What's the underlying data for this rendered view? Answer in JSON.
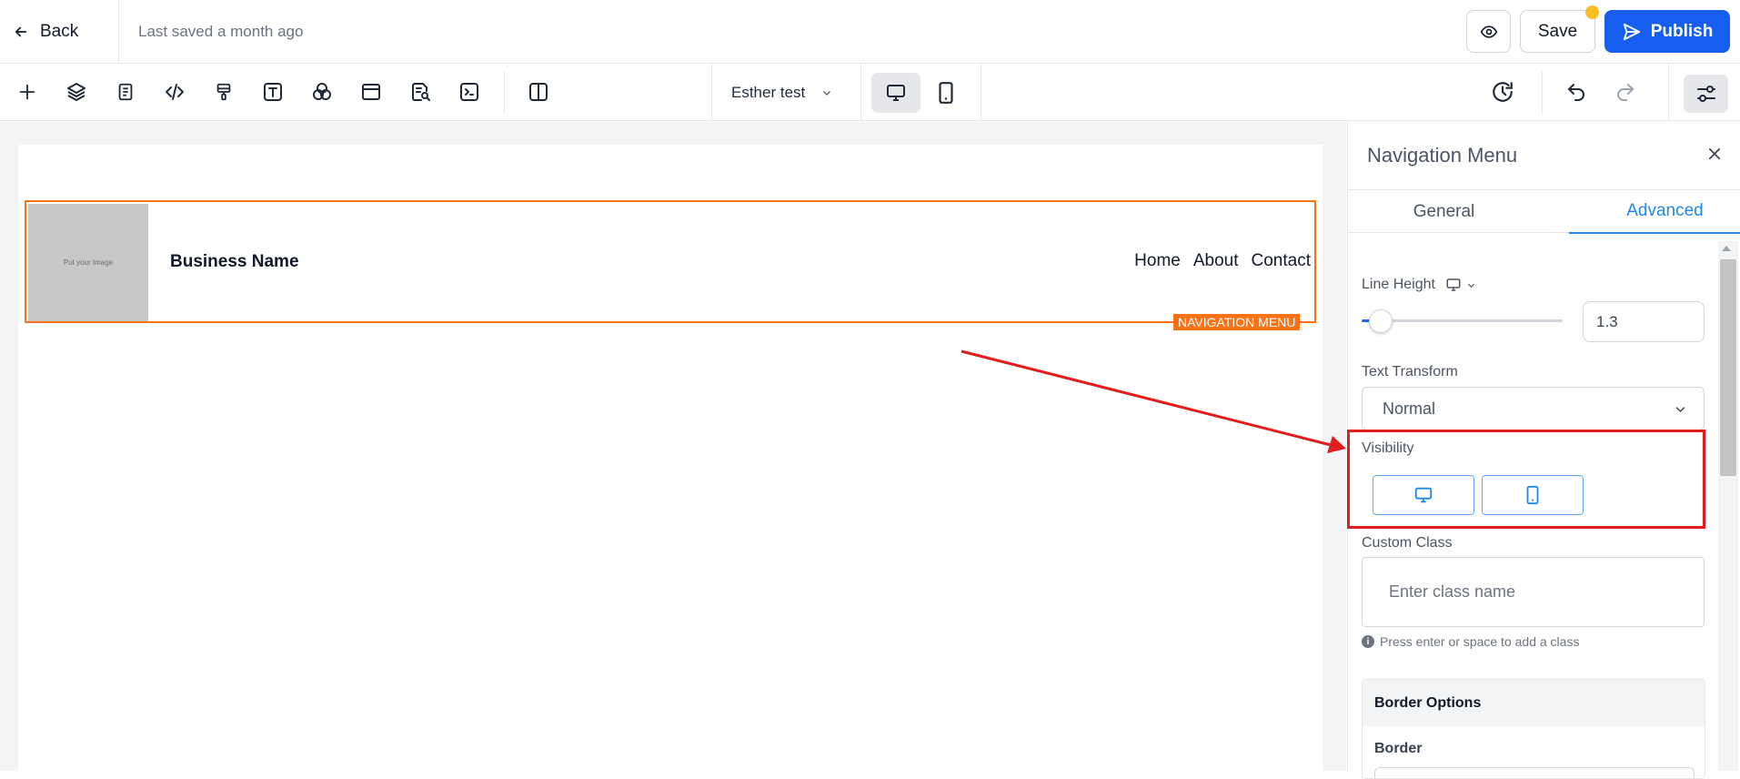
{
  "header": {
    "back_label": "Back",
    "saved_status": "Last saved a month ago",
    "save_label": "Save",
    "publish_label": "Publish"
  },
  "toolbar": {
    "page_selector": "Esther test",
    "tools": [
      "add-icon",
      "layers-icon",
      "page-icon",
      "code-icon",
      "paint-roller-icon",
      "text-icon",
      "blend-icon",
      "browser-window-icon",
      "seo-search-icon",
      "terminal-icon",
      "split-view-icon"
    ],
    "device_mode": "desktop"
  },
  "canvas": {
    "image_placeholder": "Put your Image",
    "business_name": "Business Name",
    "nav_links": [
      "Home",
      "About",
      "Contact"
    ],
    "element_tag": "NAVIGATION MENU"
  },
  "panel": {
    "title": "Navigation Menu",
    "tabs": [
      "General",
      "Advanced"
    ],
    "active_tab": "Advanced",
    "line_height_label": "Line Height",
    "line_height_value": "1.3",
    "line_height_slider": 0.05,
    "text_transform_label": "Text Transform",
    "text_transform_value": "Normal",
    "visibility_label": "Visibility",
    "custom_class_label": "Custom Class",
    "custom_class_placeholder": "Enter class name",
    "custom_class_hint": "Press enter or space to add a class",
    "border_options_label": "Border Options",
    "border_label": "Border"
  },
  "colors": {
    "primary": "#155eef",
    "accent_blue": "#1e88e5",
    "selection_orange": "#f97316",
    "annotation_red": "#e11d1d",
    "unsaved_dot": "#fbbf24"
  }
}
